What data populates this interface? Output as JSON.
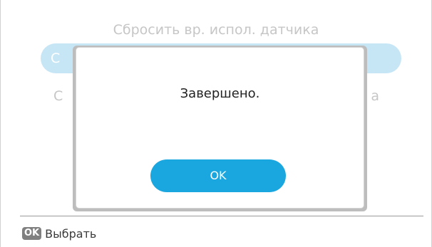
{
  "menu": {
    "items": [
      {
        "label": "Сбросить вр. испол. датчика"
      },
      {
        "label": "С"
      },
      {
        "label": "С",
        "tail": "а"
      }
    ]
  },
  "dialog": {
    "message": "Завершено.",
    "ok_label": "OK"
  },
  "footer": {
    "key_badge": "OK",
    "label": "Выбрать"
  },
  "colors": {
    "accent": "#1aa6df",
    "selected_row": "#c6e6f6",
    "dimmed_text": "#c6c6c6"
  }
}
